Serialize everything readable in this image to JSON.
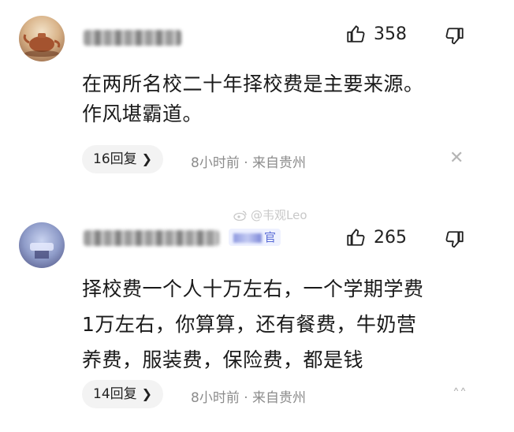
{
  "comments": [
    {
      "likes": "358",
      "text_lines": [
        "在两所名校二十年择校费是主要来源。",
        "作风堪霸道。"
      ],
      "reply_label": "16回复",
      "meta": "8小时前 · 来自贵州"
    },
    {
      "badge_suffix": "官",
      "likes": "265",
      "text_lines": [
        "择校费一个人十万左右，一个学期学费",
        "1万左右，你算算，还有餐费，牛奶营",
        "养费，服装费，保险费，都是钱"
      ],
      "reply_label": "14回复",
      "meta": "8小时前 · 来自贵州"
    }
  ],
  "watermark": "@韦观Leo",
  "icons": {
    "like": "thumbs-up-icon",
    "dislike": "thumbs-down-icon",
    "chevron": "chevron-right-icon",
    "close": "close-icon",
    "more": "more-icon"
  }
}
